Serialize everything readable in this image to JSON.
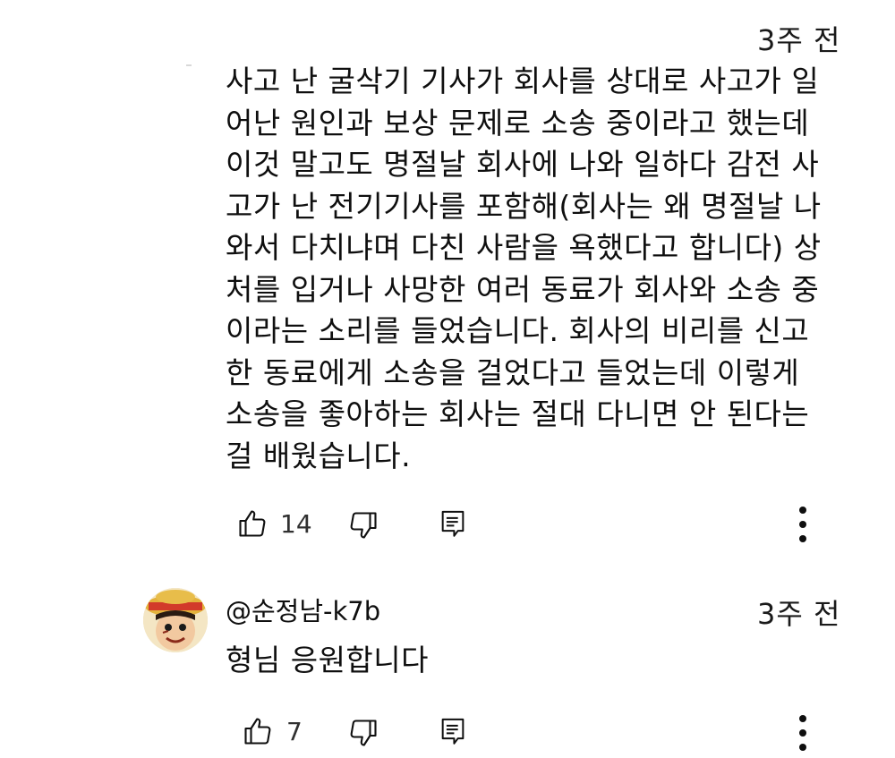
{
  "comments": [
    {
      "timestamp": "3주 전",
      "text": "사고 난 굴삭기 기사가 회사를 상대로 사고가 일\n어난 원인과 보상 문제로 소송 중이라고 했는데\n이것 말고도 명절날 회사에 나와 일하다 감전 사\n고가 난 전기기사를 포함해(회사는 왜 명절날 나\n와서 다치냐며 다친 사람을 욕했다고 합니다) 상\n처를 입거나 사망한 여러 동료가 회사와 소송 중\n이라는 소리를 들었습니다. 회사의 비리를 신고\n한 동료에게 소송을 걸었다고 들었는데 이렇게\n소송을 좋아하는 회사는 절대 다니면 안 된다는\n걸 배웠습니다.",
      "like_count": "14"
    },
    {
      "username": "@순정남-k7b",
      "timestamp": "3주 전",
      "text": "형님 응원합니다",
      "like_count": "7"
    }
  ]
}
